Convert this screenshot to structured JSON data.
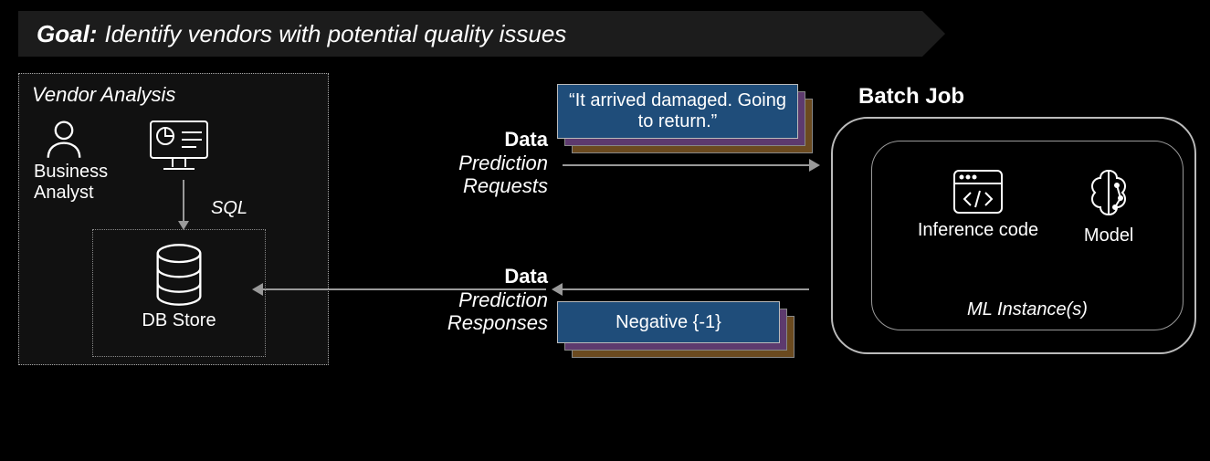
{
  "goal": {
    "prefix": "Goal:",
    "text": "Identify vendors with potential quality issues"
  },
  "vendor": {
    "title": "Vendor Analysis",
    "analyst_label": "Business Analyst",
    "sql_label": "SQL",
    "db_label": "DB Store"
  },
  "flows": {
    "request": {
      "heading": "Data",
      "sub": "Prediction Requests"
    },
    "response": {
      "heading": "Data",
      "sub": "Prediction Responses"
    }
  },
  "cards": {
    "request_text": "“It arrived damaged. Going to return.”",
    "response_text": "Negative {-1}"
  },
  "batch": {
    "title": "Batch Job",
    "inference_label": "Inference code",
    "model_label": "Model",
    "instance_label": "ML Instance(s)"
  }
}
